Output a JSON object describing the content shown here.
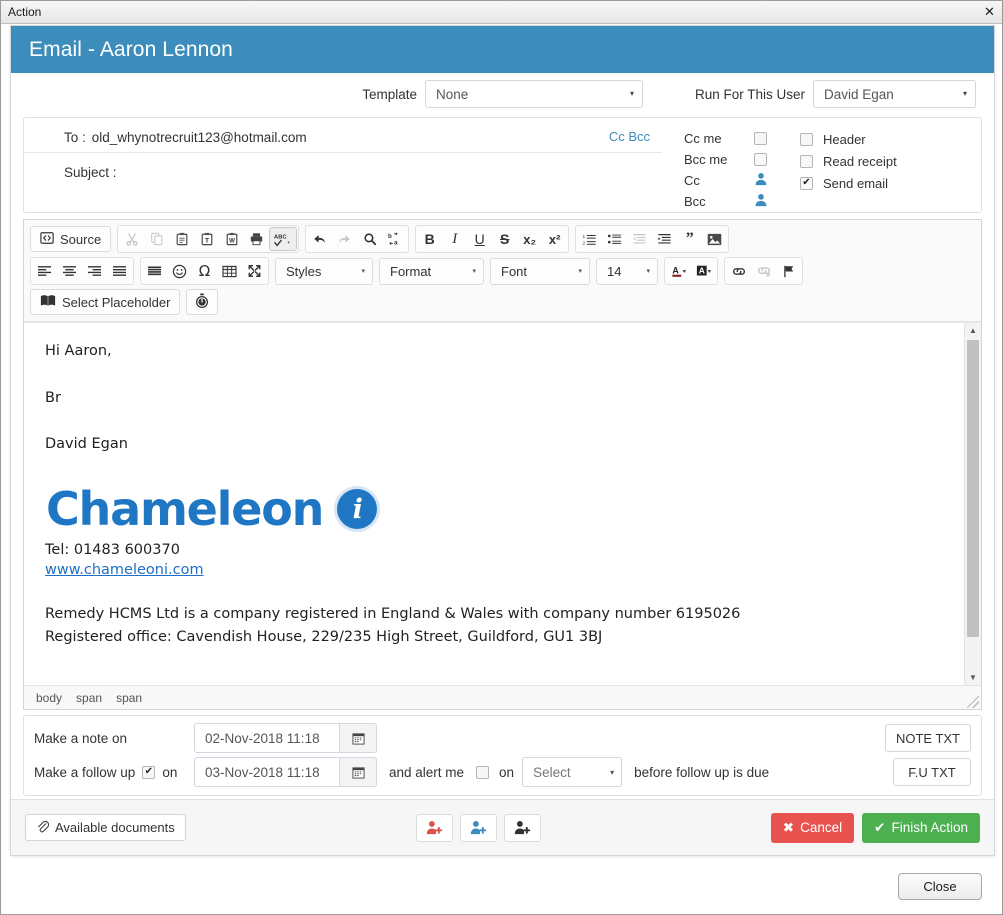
{
  "window": {
    "title": "Action",
    "close_icon": "close-icon",
    "close_glyph": "✕"
  },
  "modal": {
    "header_title": "Email - Aaron Lennon",
    "header_color": "#3c8dbc"
  },
  "template_row": {
    "template_label": "Template",
    "template_value": "None",
    "user_label": "Run For This User",
    "user_value": "David Egan",
    "caret_glyph": "▾"
  },
  "recipients": {
    "to_label": "To :",
    "to_value": "old_whynotrecruit123@hotmail.com",
    "subject_label": "Subject :",
    "subject_value": "",
    "ccbcc_link": "Cc Bcc",
    "options_left": [
      {
        "label": "Cc me",
        "type": "checkbox",
        "checked": false
      },
      {
        "label": "Bcc me",
        "type": "checkbox",
        "checked": false
      },
      {
        "label": "Cc",
        "type": "person",
        "icon": "person-icon"
      },
      {
        "label": "Bcc",
        "type": "person",
        "icon": "person-icon"
      }
    ],
    "options_right": [
      {
        "label": "Header",
        "checked": false
      },
      {
        "label": "Read receipt",
        "checked": false
      },
      {
        "label": "Send email",
        "checked": true
      }
    ]
  },
  "toolbar": {
    "row1": {
      "source_label": "Source",
      "group_clipboard": [
        {
          "name": "cut-icon",
          "disabled": true
        },
        {
          "name": "copy-icon",
          "disabled": true
        },
        {
          "name": "paste-icon",
          "disabled": false
        },
        {
          "name": "paste-text-icon",
          "disabled": false
        },
        {
          "name": "paste-word-icon",
          "disabled": false
        },
        {
          "name": "print-icon",
          "disabled": false
        },
        {
          "name": "spellcheck-icon",
          "disabled": false,
          "active": true
        }
      ],
      "group_history": [
        {
          "name": "undo-icon",
          "disabled": false
        },
        {
          "name": "redo-icon",
          "disabled": true
        },
        {
          "name": "find-icon",
          "disabled": false
        },
        {
          "name": "replace-icon",
          "disabled": false
        }
      ],
      "group_format": [
        {
          "name": "bold-icon",
          "label": "B"
        },
        {
          "name": "italic-icon",
          "label": "I"
        },
        {
          "name": "underline-icon",
          "label": "U"
        },
        {
          "name": "strikethrough-icon",
          "label": "S"
        },
        {
          "name": "subscript-icon",
          "label": "x₂"
        },
        {
          "name": "superscript-icon",
          "label": "x²"
        }
      ],
      "group_lists": [
        {
          "name": "numbered-list-icon",
          "disabled": false
        },
        {
          "name": "bulleted-list-icon",
          "disabled": false
        },
        {
          "name": "outdent-icon",
          "disabled": true
        },
        {
          "name": "indent-icon",
          "disabled": false
        },
        {
          "name": "blockquote-icon",
          "disabled": false
        },
        {
          "name": "image-icon",
          "disabled": false
        }
      ]
    },
    "row2": {
      "group_align": [
        {
          "name": "align-left-icon"
        },
        {
          "name": "align-center-icon"
        },
        {
          "name": "align-right-icon"
        },
        {
          "name": "align-justify-icon"
        }
      ],
      "group_insert": [
        {
          "name": "horizontal-rule-icon"
        },
        {
          "name": "smiley-icon"
        },
        {
          "name": "special-character-icon"
        },
        {
          "name": "table-icon"
        },
        {
          "name": "maximize-icon"
        }
      ],
      "styles_value": "Styles",
      "format_value": "Format",
      "font_value": "Font",
      "size_value": "14",
      "group_color": [
        {
          "name": "text-color-icon",
          "label": "A"
        },
        {
          "name": "background-color-icon",
          "label": "A"
        }
      ],
      "group_link": [
        {
          "name": "link-icon",
          "disabled": false
        },
        {
          "name": "unlink-icon",
          "disabled": true
        },
        {
          "name": "anchor-flag-icon",
          "disabled": false
        }
      ]
    },
    "row3": {
      "placeholder_label": "Select Placeholder",
      "placeholder_icon": "book-icon",
      "timer_icon": "stopwatch-icon"
    }
  },
  "email_body": {
    "greeting": "Hi Aaron,",
    "line_br": "Br",
    "sender": "David Egan",
    "brand": "Chameleon",
    "brand_badge": "i",
    "tel": "Tel: 01483 600370",
    "website": "www.chameleoni.com",
    "legal_line1": "Remedy HCMS Ltd is a company registered in England & Wales with company number 6195026",
    "legal_line2": "Registered office: Cavendish House, 229/235 High Street, Guildford, GU1 3BJ"
  },
  "path_bar": {
    "items": [
      "body",
      "span",
      "span"
    ]
  },
  "notes": {
    "note_label": "Make a note on",
    "note_date": "02-Nov-2018 11:18",
    "note_button": "NOTE TXT",
    "follow_label": "Make a follow up",
    "follow_checked": true,
    "follow_on": "on",
    "follow_date": "03-Nov-2018 11:18",
    "alert_label": "and alert me",
    "alert_checked": false,
    "alert_on": "on",
    "alert_select": "Select",
    "alert_suffix": "before follow up is due",
    "follow_button": "F.U TXT",
    "calendar_icon": "calendar-icon"
  },
  "footer": {
    "documents_label": "Available documents",
    "documents_icon": "paperclip-icon",
    "user_buttons": [
      {
        "name": "add-contact-red-icon",
        "color": "#d9534f"
      },
      {
        "name": "add-contact-blue-icon",
        "color": "#3c8dbc"
      },
      {
        "name": "add-contact-black-icon",
        "color": "#333333"
      }
    ],
    "cancel_label": "Cancel",
    "cancel_icon": "cross-icon",
    "cancel_color": "#e9534f",
    "finish_label": "Finish Action",
    "finish_icon": "check-icon",
    "finish_color": "#4cb050"
  },
  "outer": {
    "close_label": "Close"
  }
}
